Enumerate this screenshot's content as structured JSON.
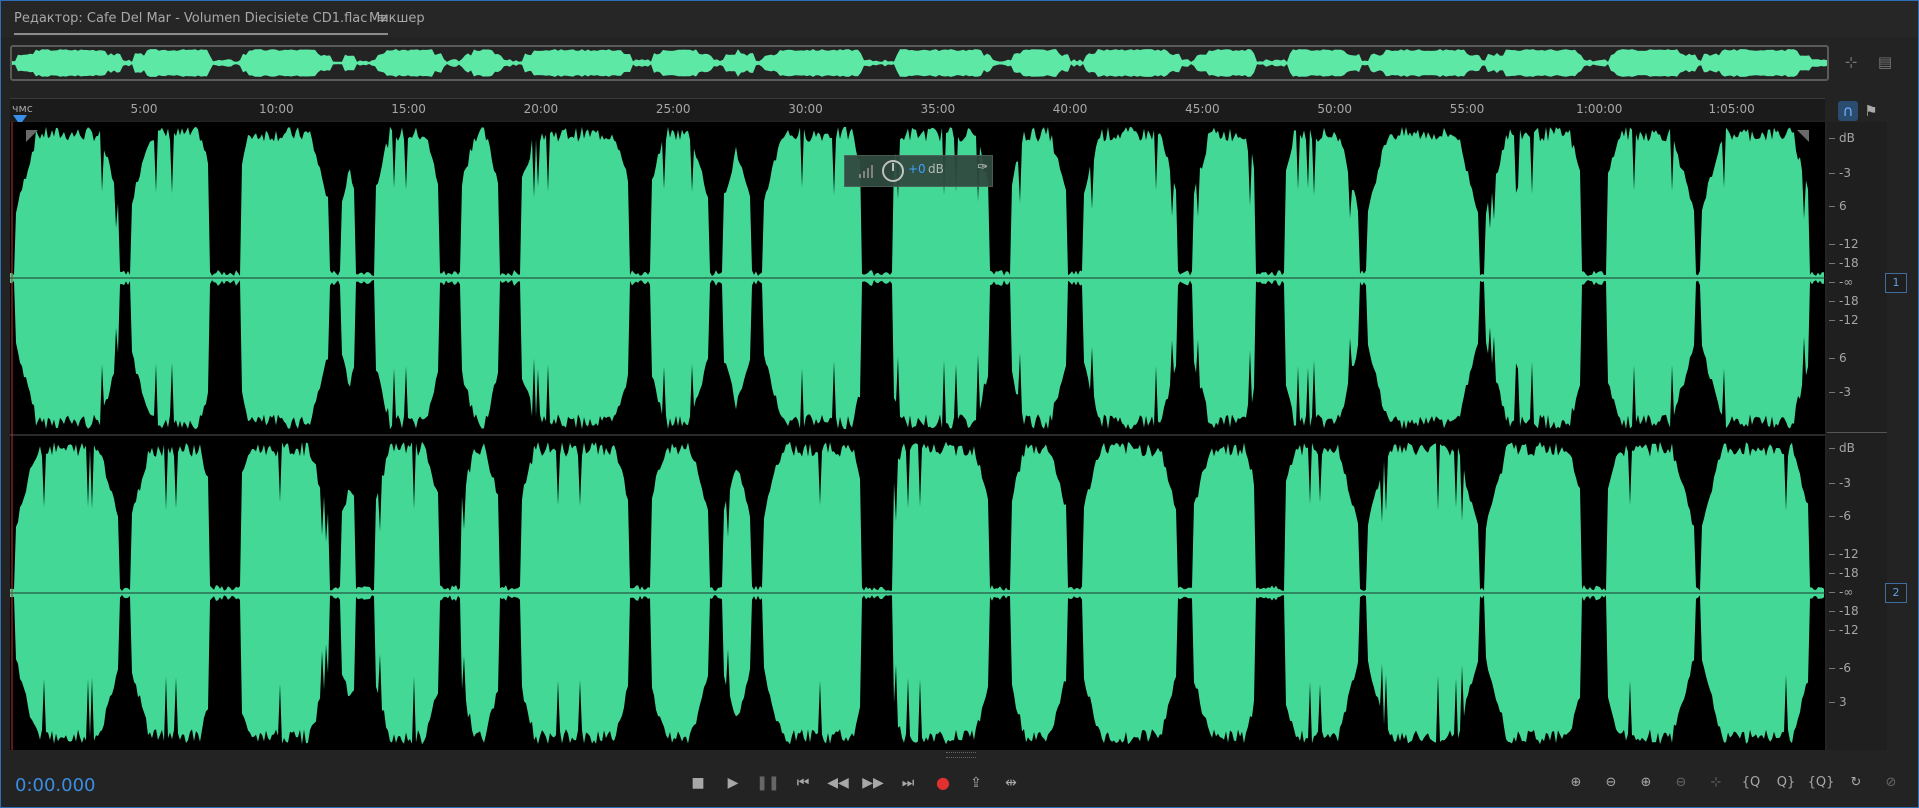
{
  "tabs": {
    "editor": {
      "label": "Редактор: Cafe Del Mar - Volumen Diecisiete CD1.flac",
      "menu_icon": "hamburger-menu-icon"
    },
    "mixer": {
      "label": "Микшер"
    }
  },
  "overview": {
    "icons": [
      "zoom-out-full-icon",
      "panel-options-icon"
    ]
  },
  "ruler": {
    "unit": "чмс",
    "labels": [
      "5:00",
      "10:00",
      "15:00",
      "20:00",
      "25:00",
      "30:00",
      "35:00",
      "40:00",
      "45:00",
      "50:00",
      "55:00",
      "1:00:00",
      "1:05:00"
    ]
  },
  "db_scale": {
    "channel1": [
      "dB",
      "-3",
      "6",
      "-12",
      "-18",
      "-∞",
      "-18",
      "-12",
      "6",
      "-3"
    ],
    "channel2": [
      "dB",
      "-3",
      "-6",
      "-12",
      "-18",
      "-∞",
      "-18",
      "-12",
      "-6",
      "3"
    ],
    "channels": [
      "1",
      "2"
    ]
  },
  "hud": {
    "value": "+0",
    "unit": "dB"
  },
  "transport": {
    "time": "0:00.000",
    "buttons": [
      "stop-icon",
      "play-icon",
      "pause-icon",
      "go-to-start-icon",
      "rewind-icon",
      "fast-forward-icon",
      "go-to-end-icon",
      "record-icon",
      "loop-playback-icon",
      "skip-selection-icon"
    ]
  },
  "zoom": {
    "buttons": [
      "zoom-in-amplitude-icon",
      "zoom-out-amplitude-icon",
      "zoom-in-time-icon",
      "zoom-out-time-icon",
      "zoom-out-full-icon",
      "zoom-in-at-in-point-icon",
      "zoom-in-at-out-point-icon",
      "zoom-to-selection-icon",
      "zoom-selected-tracks-icon",
      "zoom-reset-icon"
    ]
  },
  "colors": {
    "waveform": "#44d897",
    "overview_wave": "#5ee8a6",
    "accent": "#3b8de0",
    "record": "#e03030",
    "background": "#232323"
  }
}
